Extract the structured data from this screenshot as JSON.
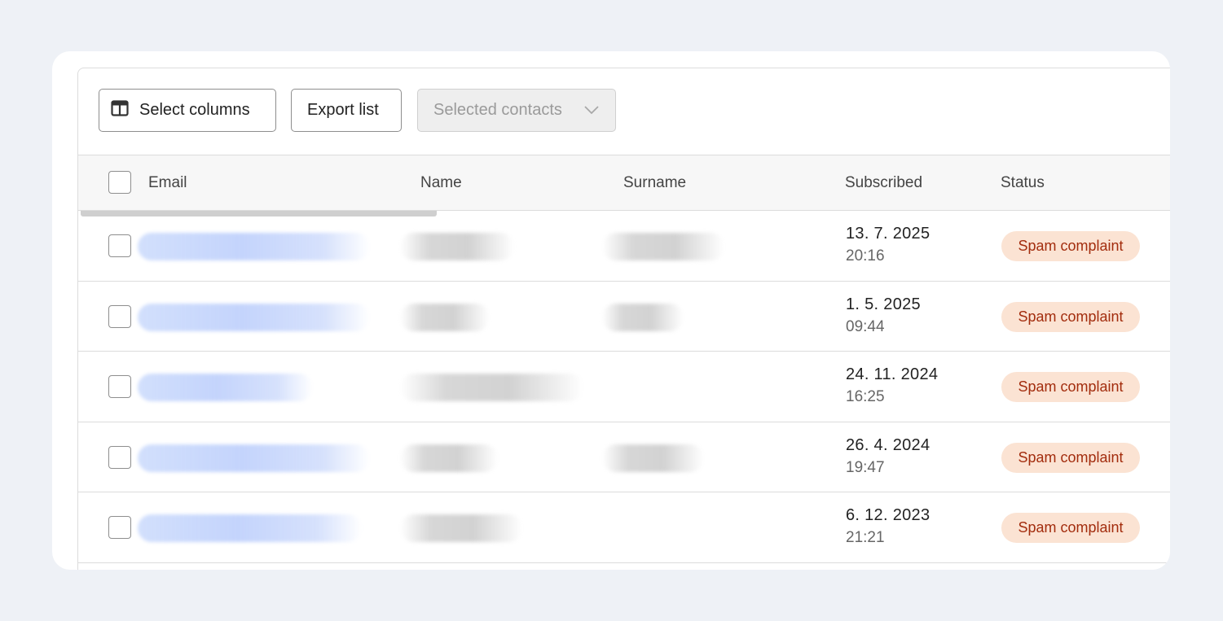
{
  "toolbar": {
    "select_columns_label": "Select columns",
    "select_columns_icon": "columns-icon",
    "export_label": "Export list",
    "selected_contacts_label": "Selected contacts",
    "selected_contacts_icon": "chevron-down-icon"
  },
  "table": {
    "columns": [
      "Email",
      "Name",
      "Surname",
      "Subscribed",
      "Status"
    ],
    "rows": [
      {
        "subscribed_date": "13. 7. 2025",
        "subscribed_time": "20:16",
        "status": "Spam complaint"
      },
      {
        "subscribed_date": "1. 5. 2025",
        "subscribed_time": "09:44",
        "status": "Spam complaint"
      },
      {
        "subscribed_date": "24. 11. 2024",
        "subscribed_time": "16:25",
        "status": "Spam complaint"
      },
      {
        "subscribed_date": "26. 4. 2024",
        "subscribed_time": "19:47",
        "status": "Spam complaint"
      },
      {
        "subscribed_date": "6. 12. 2023",
        "subscribed_time": "21:21",
        "status": "Spam complaint"
      }
    ]
  },
  "colors": {
    "page_bg": "#eef1f6",
    "badge_bg": "#fbe3d3",
    "badge_text": "#a32d0e",
    "email_blur": "#c4d4fc"
  }
}
